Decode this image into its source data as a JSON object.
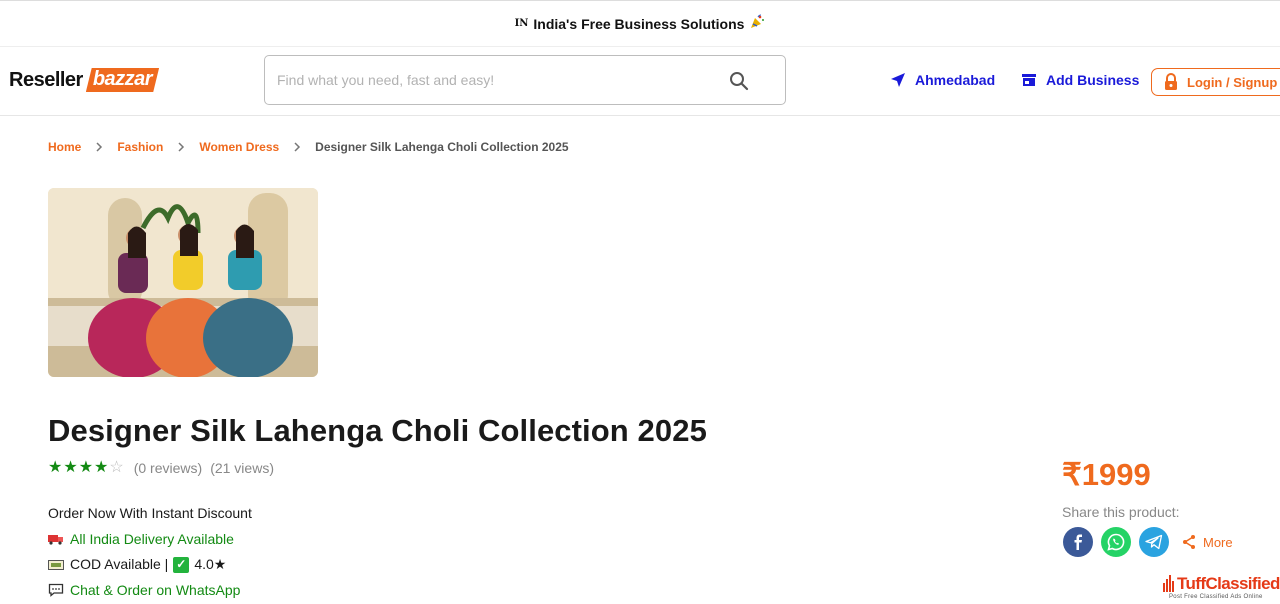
{
  "topbar": {
    "flag_code": "IN",
    "text": "India's Free Business Solutions"
  },
  "header": {
    "logo_part1": "Reseller",
    "logo_part2": "bazzar",
    "search_placeholder": "Find what you need, fast and easy!",
    "location": "Ahmedabad",
    "add_business": "Add Business",
    "login": "Login / Signup"
  },
  "breadcrumb": [
    {
      "label": "Home"
    },
    {
      "label": "Fashion"
    },
    {
      "label": "Women Dress"
    },
    {
      "label": "Designer Silk Lahenga Choli Collection 2025"
    }
  ],
  "product": {
    "title": "Designer Silk Lahenga Choli Collection 2025",
    "rating_stars": 4,
    "rating_max": 5,
    "reviews": "(0 reviews)",
    "views": "(21 views)",
    "description": {
      "line1": "Order Now With Instant Discount",
      "line2": "All India Delivery Available",
      "line3_a": "COD Available |",
      "line3_b": "4.0★",
      "line4": "Chat & Order on WhatsApp"
    },
    "price": "₹1999",
    "share_label": "Share this product:",
    "more": "More"
  },
  "watermark": {
    "title_a": "Tuff",
    "title_b": "Classified",
    "subtitle": "Post Free Classified Ads Online"
  },
  "colors": {
    "accent": "#ef6a1e",
    "link_blue": "#1a1ad9",
    "star_green": "#138a13"
  }
}
